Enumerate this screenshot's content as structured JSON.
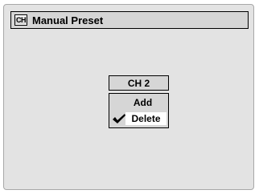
{
  "header": {
    "icon": "CH",
    "icon_name": "channel-icon",
    "title": "Manual Preset"
  },
  "channel": {
    "label": "CH 2"
  },
  "menu": {
    "items": [
      {
        "label": "Add",
        "selected": false
      },
      {
        "label": "Delete",
        "selected": true,
        "checked": true
      }
    ]
  },
  "colors": {
    "background": "#e3e3e3",
    "panel": "#d6d6d6",
    "highlight": "#ffffff",
    "text": "#000000"
  }
}
